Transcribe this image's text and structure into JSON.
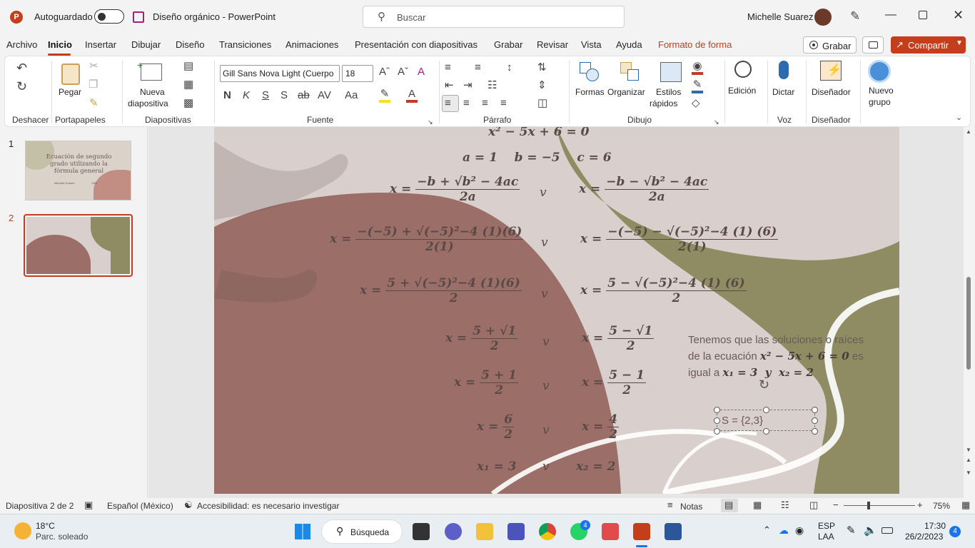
{
  "titlebar": {
    "autosave_label": "Autoguardado",
    "doc_title": "Diseño orgánico",
    "app_name": "PowerPoint",
    "search_placeholder": "Buscar",
    "user_name": "Michelle Suarez"
  },
  "tabs": {
    "items": [
      "Archivo",
      "Inicio",
      "Insertar",
      "Dibujar",
      "Diseño",
      "Transiciones",
      "Animaciones",
      "Presentación con diapositivas",
      "Grabar",
      "Revisar",
      "Vista",
      "Ayuda",
      "Formato de forma"
    ],
    "record_label": "Grabar",
    "share_label": "Compartir"
  },
  "ribbon": {
    "groups": [
      "Deshacer",
      "Portapapeles",
      "Diapositivas",
      "Fuente",
      "Párrafo",
      "Dibujo",
      "Voz",
      "Diseñador"
    ],
    "paste": "Pegar",
    "new_slide_1": "Nueva",
    "new_slide_2": "diapositiva",
    "font_name": "Gill Sans Nova Light (Cuerpo",
    "font_size": "18",
    "bold": "N",
    "italic": "K",
    "underline": "S",
    "shapes": "Formas",
    "arrange": "Organizar",
    "styles_1": "Estilos",
    "styles_2": "rápidos",
    "editing": "Edición",
    "dictate": "Dictar",
    "designer": "Diseñador",
    "new_group_1": "Nuevo",
    "new_group_2": "grupo"
  },
  "thumbnails": {
    "numbers": [
      "1",
      "2"
    ],
    "slide1_title": "Ecuación de segundo grado utilizando la fórmula general",
    "slide1_author": "Michelle Suarez",
    "slide1_code": "CBD"
  },
  "slide": {
    "eq_top": "x² − 5x + 6 = 0",
    "coeffs": "a = 1    b = −5    c = 6",
    "or": "v",
    "f1_num_l": "−b + √b² − 4ac",
    "f1_num_r": "−b − √b² − 4ac",
    "f1_den": "2a",
    "f2_num_l": "−(−5) + √(−5)²−4 (1)(6)",
    "f2_num_r": "−(−5) − √(−5)²−4 (1) (6)",
    "f2_den": "2(1)",
    "f3_num_l": "5 + √(−5)²−4 (1)(6)",
    "f3_num_r": "5 − √(−5)²−4 (1) (6)",
    "f3_den": "2",
    "f4_num_l": "5 + √1",
    "f4_num_r": "5 − √1",
    "f4_den": "2",
    "f5_num_l": "5 + 1",
    "f5_num_r": "5 − 1",
    "f5_den": "2",
    "f6_num_l": "6",
    "f6_num_r": "4",
    "f6_den": "2",
    "res_l": "x₁ = 3",
    "res_r": "x₂ = 2",
    "x_eq": "x =",
    "note_1": "Tenemos que las soluciones o raíces",
    "note_2a": "de la ecuación",
    "note_2b": "x² − 5x + 6 = 0",
    "note_2c": "es",
    "note_3a": "igual a",
    "note_3b": "x₁ = 3  y  x₂ = 2",
    "set_text": "S = {2,3}"
  },
  "status": {
    "slide_info": "Diapositiva 2 de 2",
    "language": "Español (México)",
    "accessibility": "Accesibilidad: es necesario investigar",
    "notes": "Notas",
    "zoom": "75%"
  },
  "taskbar": {
    "temp": "18°C",
    "weather": "Parc. soleado",
    "search": "Búsqueda",
    "lang_1": "ESP",
    "lang_2": "LAA",
    "time": "17:30",
    "date": "26/2/2023",
    "notif": "4",
    "whatsapp_badge": "4"
  },
  "colors": {
    "accent": "#c43e1c",
    "slide_bg": "#d9cfcc",
    "olive": "#8f8c63",
    "maroon": "#9c6e68"
  }
}
